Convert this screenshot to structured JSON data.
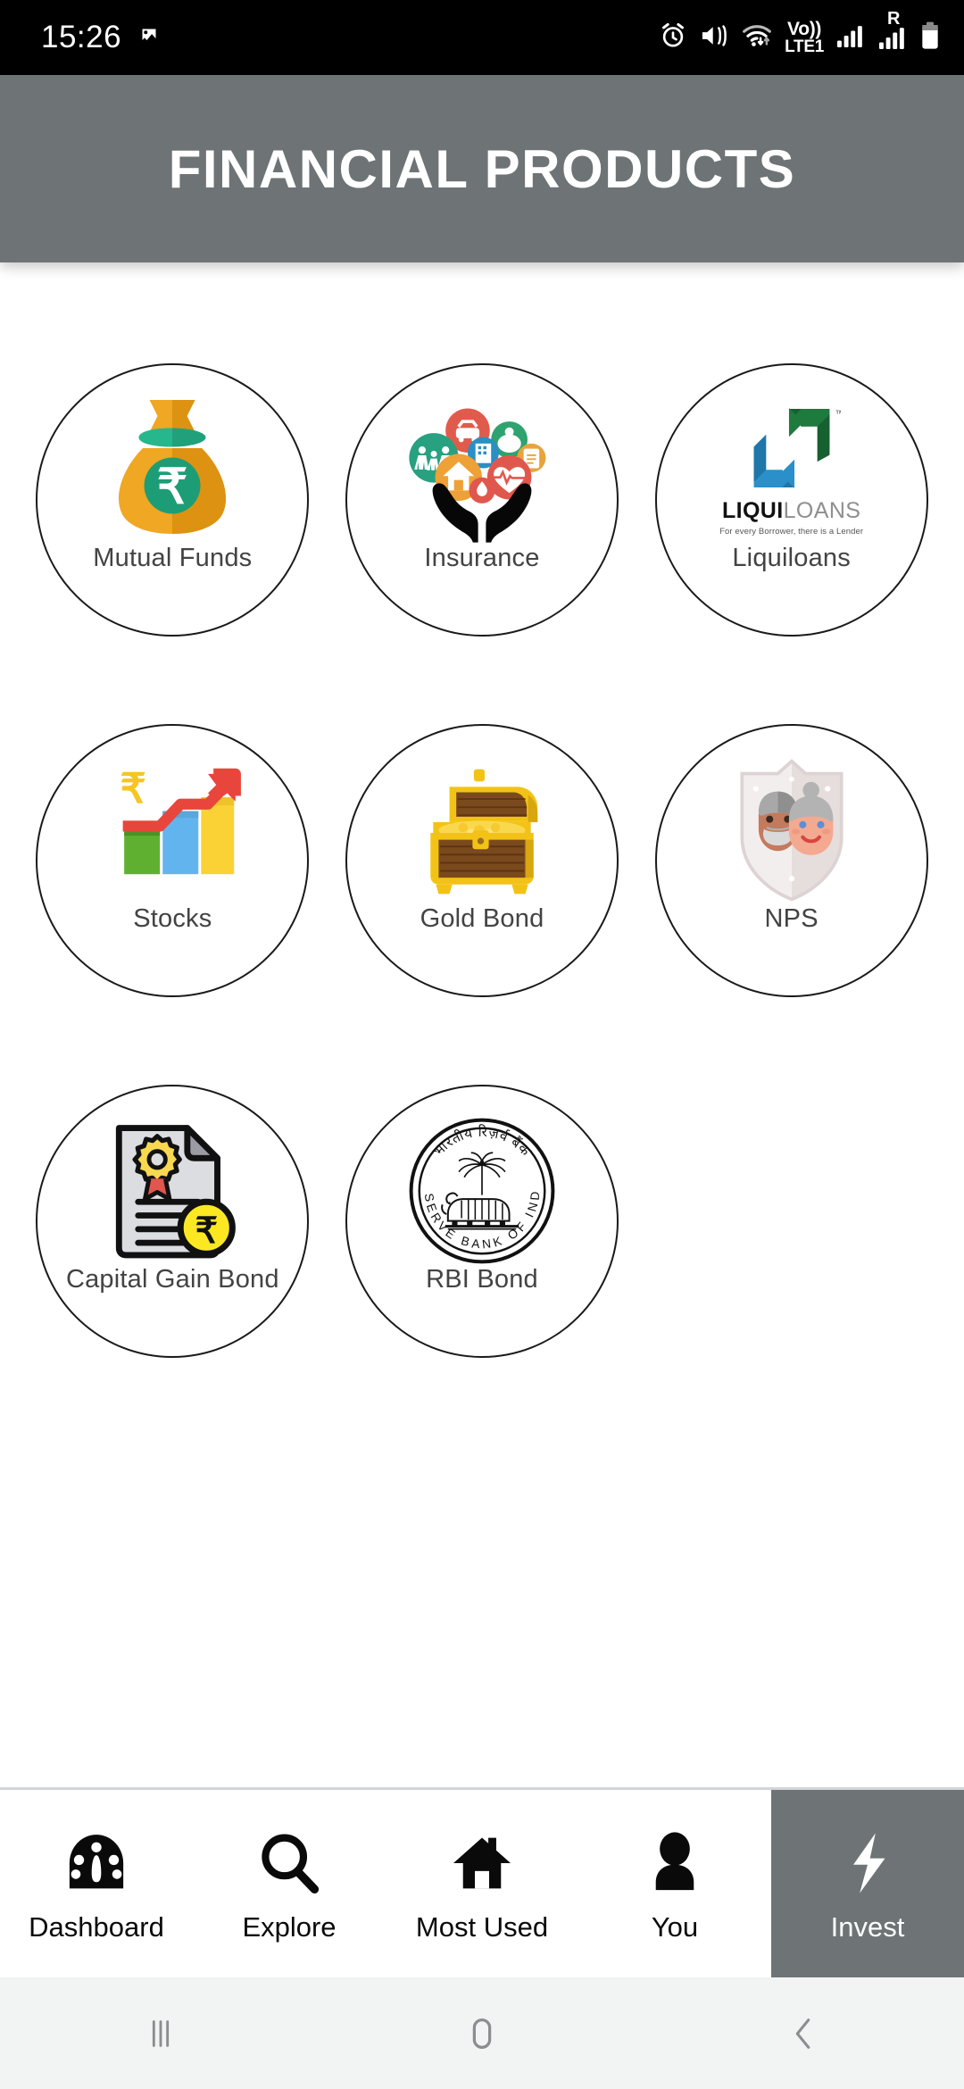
{
  "status_bar": {
    "time": "15:26",
    "left_icons": [
      "image-icon"
    ],
    "right_icons": [
      "alarm-icon",
      "mute-vibrate-icon",
      "wifi-icon",
      "volte-icon",
      "signal-icon",
      "roaming-signal-icon",
      "battery-icon"
    ],
    "volte_top": "Vo))",
    "volte_bottom": "LTE1",
    "roaming_label": "R"
  },
  "header": {
    "title": "FINANCIAL PRODUCTS",
    "background_color": "#6e7376",
    "text_color": "#ffffff"
  },
  "products": [
    {
      "label": "Mutual Funds",
      "icon": "money-bag-icon"
    },
    {
      "label": "Insurance",
      "icon": "hands-insurance-icon"
    },
    {
      "label": "Liquiloans",
      "icon": "liquiloans-logo-icon",
      "logo_text_1": "LIQUI",
      "logo_text_2": "LOANS",
      "logo_tm": "TM",
      "logo_tagline": "For every Borrower, there is a Lender"
    },
    {
      "label": "Stocks",
      "icon": "bar-chart-growth-icon"
    },
    {
      "label": "Gold Bond",
      "icon": "treasure-chest-icon"
    },
    {
      "label": "NPS",
      "icon": "shield-elderly-couple-icon"
    },
    {
      "label": "Capital Gain Bond",
      "icon": "certificate-rupee-icon"
    },
    {
      "label": "RBI Bond",
      "icon": "rbi-seal-icon",
      "seal_hindi": "भारतीय रिज़र्व बैंक",
      "seal_top": "RESERVE",
      "seal_bottom": "BANK OF INDIA"
    }
  ],
  "bottom_nav": {
    "active_index": 4,
    "active_color": "#6e7376",
    "items": [
      {
        "label": "Dashboard",
        "icon": "speedometer-icon"
      },
      {
        "label": "Explore",
        "icon": "magnifier-icon"
      },
      {
        "label": "Most Used",
        "icon": "home-icon"
      },
      {
        "label": "You",
        "icon": "person-icon"
      },
      {
        "label": "Invest",
        "icon": "lightning-bolt-icon"
      }
    ]
  },
  "system_nav": {
    "buttons": [
      {
        "name": "recents",
        "icon": "recents-icon"
      },
      {
        "name": "home",
        "icon": "home-pill-icon"
      },
      {
        "name": "back",
        "icon": "back-chevron-icon"
      }
    ]
  }
}
